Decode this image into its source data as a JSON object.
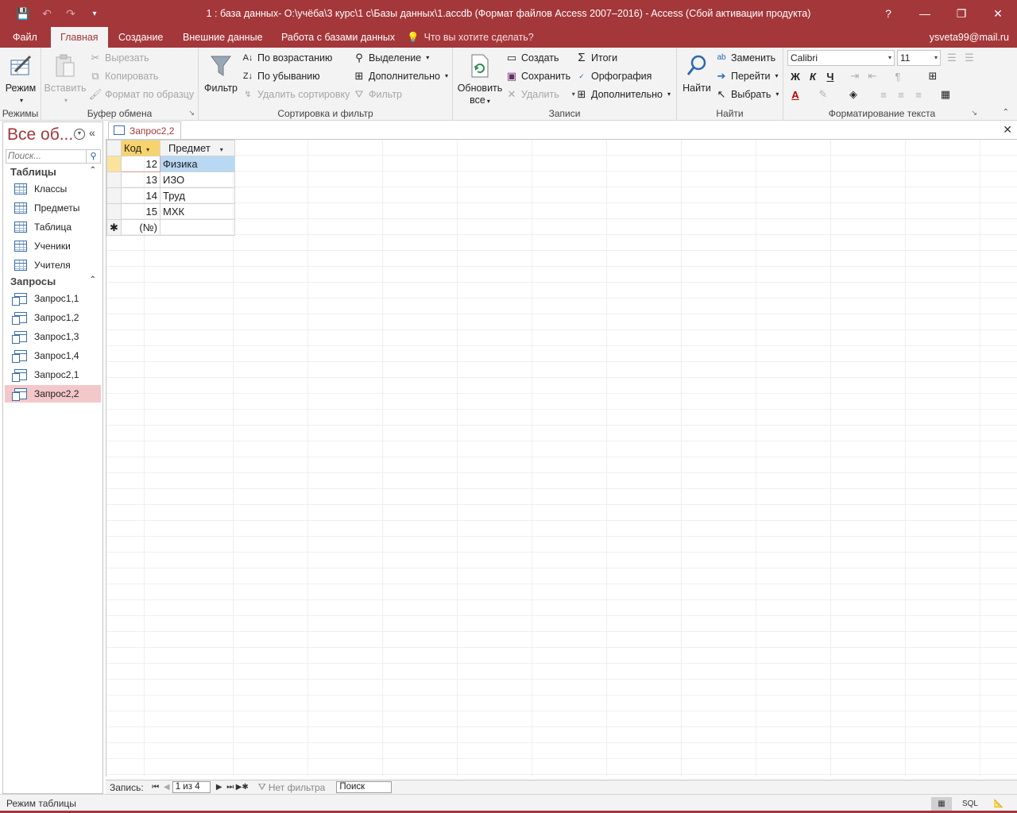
{
  "window": {
    "title": "1 : база данных- O:\\учёба\\3 курс\\1 с\\Базы данных\\1.accdb (Формат файлов Access 2007–2016) - Access (Сбой активации продукта)",
    "help": "?",
    "minimize": "—",
    "restore": "❐",
    "close": "✕"
  },
  "qat": {
    "save": "💾",
    "undo": "↶",
    "redo": "↷",
    "customize": "▾"
  },
  "tabs": [
    "Файл",
    "Главная",
    "Создание",
    "Внешние данные",
    "Работа с базами данных"
  ],
  "active_tab": "Главная",
  "tell_me": "Что вы хотите сделать?",
  "user": "ysveta99@mail.ru",
  "ribbon": {
    "modes": {
      "label": "Режимы",
      "button": "Режим"
    },
    "clipboard": {
      "label": "Буфер обмена",
      "paste": "Вставить",
      "cut": "Вырезать",
      "copy": "Копировать",
      "format_painter": "Формат по образцу"
    },
    "sort_filter": {
      "label": "Сортировка и фильтр",
      "filter": "Фильтр",
      "asc": "По возрастанию",
      "desc": "По убыванию",
      "remove_sort": "Удалить сортировку",
      "selection": "Выделение",
      "advanced": "Дополнительно",
      "toggle_filter": "Фильтр"
    },
    "records": {
      "label": "Записи",
      "refresh_line1": "Обновить",
      "refresh_line2": "все",
      "new": "Создать",
      "save": "Сохранить",
      "delete": "Удалить",
      "totals": "Итоги",
      "spelling": "Орфография",
      "more": "Дополнительно"
    },
    "find": {
      "label": "Найти",
      "find": "Найти",
      "replace": "Заменить",
      "goto": "Перейти",
      "select": "Выбрать"
    },
    "text_format": {
      "label": "Форматирование текста",
      "font": "Calibri",
      "size": "11",
      "bold": "Ж",
      "italic": "К",
      "underline": "Ч"
    }
  },
  "nav": {
    "title": "Все об...",
    "search_placeholder": "Поиск...",
    "sections": [
      {
        "name": "Таблицы",
        "items": [
          "Классы",
          "Предметы",
          "Таблица",
          "Ученики",
          "Учителя"
        ]
      },
      {
        "name": "Запросы",
        "items": [
          "Запрос1,1",
          "Запрос1,2",
          "Запрос1,3",
          "Запрос1,4",
          "Запрос2,1",
          "Запрос2,2"
        ]
      }
    ],
    "selected": "Запрос2,2"
  },
  "document": {
    "tab": "Запрос2,2",
    "columns": [
      "Код",
      "Предмет"
    ],
    "rows": [
      {
        "code": "12",
        "subject": "Физика"
      },
      {
        "code": "13",
        "subject": "ИЗО"
      },
      {
        "code": "14",
        "subject": "Труд"
      },
      {
        "code": "15",
        "subject": "МХК"
      }
    ],
    "new_row_marker": "✱",
    "new_row_code": "(№)"
  },
  "record_nav": {
    "label": "Запись:",
    "current": "1 из 4",
    "filter": "Нет фильтра",
    "search": "Поиск"
  },
  "status": {
    "text": "Режим таблицы",
    "sql": "SQL"
  },
  "colors": {
    "accent": "#a4373a",
    "selected_header": "#f8d36b",
    "selected_cell": "#b8d8f4",
    "nav_selected": "#f4c7ca"
  }
}
